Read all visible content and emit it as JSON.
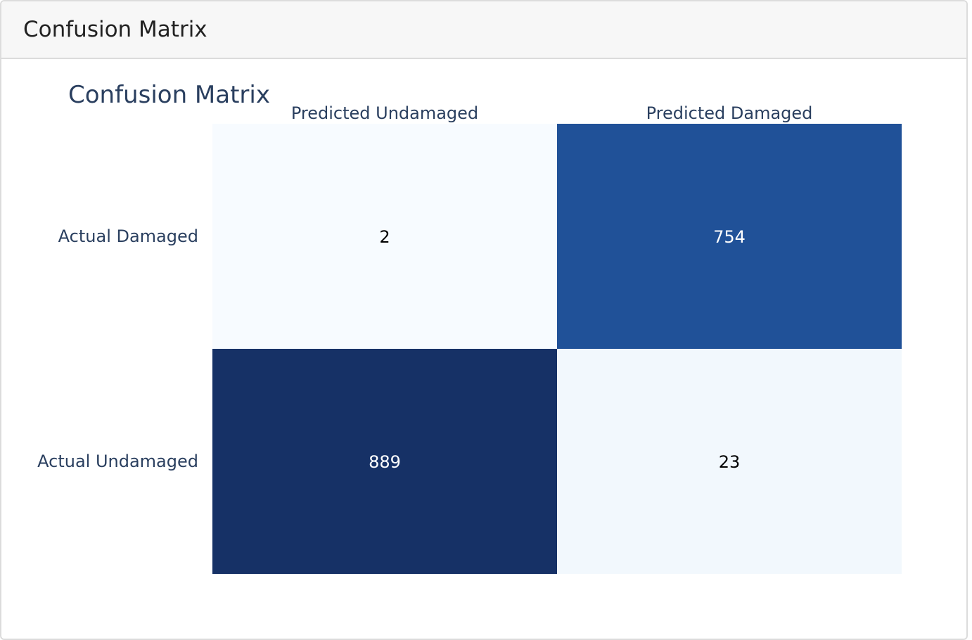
{
  "panel": {
    "title": "Confusion Matrix"
  },
  "chart_data": {
    "type": "heatmap",
    "title": "Confusion Matrix",
    "x_categories": [
      "Predicted Undamaged",
      "Predicted Damaged"
    ],
    "y_categories": [
      "Actual Damaged",
      "Actual Undamaged"
    ],
    "values": [
      [
        2,
        754
      ],
      [
        889,
        23
      ]
    ],
    "colorscale": "Blues",
    "text_colors": {
      "light_cell": "#000000",
      "dark_cell": "#ffffff"
    },
    "label_color": "#2a3f5f"
  }
}
